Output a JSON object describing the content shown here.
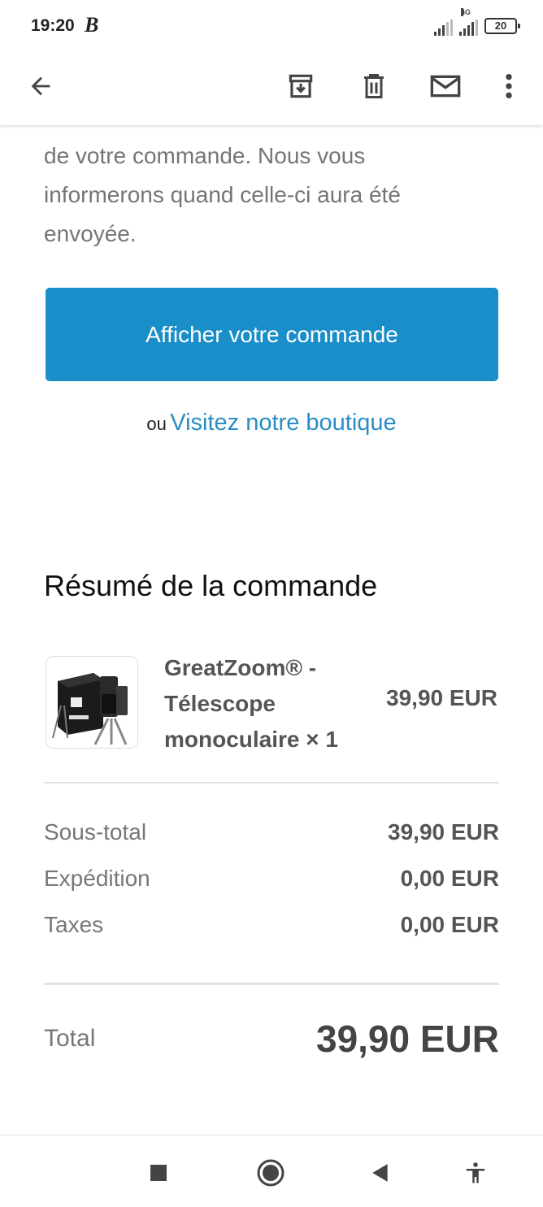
{
  "status_bar": {
    "time": "19:20",
    "carrier_glyph": "B",
    "network_label": "4G",
    "battery_level": "20"
  },
  "toolbar": {
    "back_icon": "arrow-left-icon",
    "archive_icon": "archive-icon",
    "delete_icon": "trash-icon",
    "mark_unread_icon": "mail-icon",
    "more_icon": "more-vertical-icon"
  },
  "email": {
    "body_lines": [
      "de votre commande. Nous vous",
      "informerons quand celle-ci aura été",
      "envoyée."
    ],
    "cta_label": "Afficher votre commande",
    "alt_prefix": "ou",
    "alt_link": "Visitez notre boutique"
  },
  "summary": {
    "title": "Résumé de la commande",
    "item": {
      "name_lines": [
        "GreatZoom® -",
        "Télescope",
        "monoculaire × 1"
      ],
      "price": "39,90 EUR"
    },
    "rows": [
      {
        "label": "Sous-total",
        "value": "39,90 EUR"
      },
      {
        "label": "Expédition",
        "value": "0,00 EUR"
      },
      {
        "label": "Taxes",
        "value": "0,00 EUR"
      }
    ],
    "total_label": "Total",
    "total_value": "39,90 EUR"
  },
  "colors": {
    "cta": "#1a8ec9",
    "link": "#2a8dc5"
  },
  "nav_bar": {
    "recents_icon": "square-icon",
    "home_icon": "circle-icon",
    "back_icon": "triangle-back-icon",
    "accessibility_icon": "accessibility-icon"
  }
}
